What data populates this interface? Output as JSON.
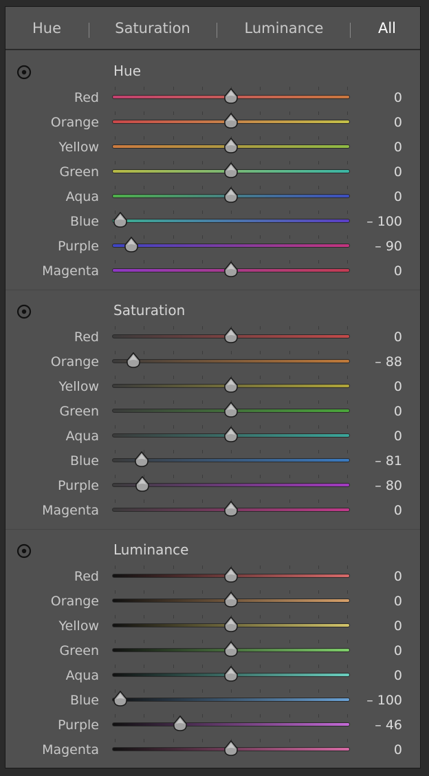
{
  "tabs": [
    {
      "label": "Hue",
      "active": false
    },
    {
      "label": "Saturation",
      "active": false
    },
    {
      "label": "Luminance",
      "active": false
    },
    {
      "label": "All",
      "active": true
    }
  ],
  "icons": {
    "target": "target-adjustment-icon",
    "thumb": "slider-thumb-icon"
  },
  "slider_range": [
    -100,
    100
  ],
  "sections": [
    {
      "key": "hue",
      "title": "Hue",
      "rows": [
        {
          "label": "Red",
          "value": 0,
          "display": "0",
          "colors": [
            "#c2416f",
            "#c9773f"
          ]
        },
        {
          "label": "Orange",
          "value": 0,
          "display": "0",
          "colors": [
            "#c9474a",
            "#c3c048"
          ]
        },
        {
          "label": "Yellow",
          "value": 0,
          "display": "0",
          "colors": [
            "#cc7a3f",
            "#8fbb45"
          ]
        },
        {
          "label": "Green",
          "value": 0,
          "display": "0",
          "colors": [
            "#b7b945",
            "#3bb6a5"
          ]
        },
        {
          "label": "Aqua",
          "value": 0,
          "display": "0",
          "colors": [
            "#4fb04a",
            "#3d4ec0"
          ]
        },
        {
          "label": "Blue",
          "value": -100,
          "display": "– 100",
          "colors": [
            "#3bb08f",
            "#5b3ec6"
          ]
        },
        {
          "label": "Purple",
          "value": -90,
          "display": "– 90",
          "colors": [
            "#3d45c4",
            "#c3357d"
          ]
        },
        {
          "label": "Magenta",
          "value": 0,
          "display": "0",
          "colors": [
            "#8d38c4",
            "#c33c52"
          ]
        }
      ]
    },
    {
      "key": "saturation",
      "title": "Saturation",
      "rows": [
        {
          "label": "Red",
          "value": 0,
          "display": "0",
          "colors": [
            "#3a3a3a",
            "#c24a4a"
          ]
        },
        {
          "label": "Orange",
          "value": -88,
          "display": "– 88",
          "colors": [
            "#3a3a3a",
            "#c07a3a"
          ]
        },
        {
          "label": "Yellow",
          "value": 0,
          "display": "0",
          "colors": [
            "#3a3a3a",
            "#b0a63a"
          ]
        },
        {
          "label": "Green",
          "value": 0,
          "display": "0",
          "colors": [
            "#3a3a3a",
            "#4aa63a"
          ]
        },
        {
          "label": "Aqua",
          "value": 0,
          "display": "0",
          "colors": [
            "#3a3a3a",
            "#3aa69a"
          ]
        },
        {
          "label": "Blue",
          "value": -81,
          "display": "– 81",
          "colors": [
            "#3a3a3a",
            "#3a7ac0"
          ]
        },
        {
          "label": "Purple",
          "value": -80,
          "display": "– 80",
          "colors": [
            "#3a3a3a",
            "#a23ac0"
          ]
        },
        {
          "label": "Magenta",
          "value": 0,
          "display": "0",
          "colors": [
            "#3a3a3a",
            "#c03a8a"
          ]
        }
      ]
    },
    {
      "key": "luminance",
      "title": "Luminance",
      "rows": [
        {
          "label": "Red",
          "value": 0,
          "display": "0",
          "colors": [
            "#111111",
            "#d86a6a"
          ]
        },
        {
          "label": "Orange",
          "value": 0,
          "display": "0",
          "colors": [
            "#111111",
            "#d6a06a"
          ]
        },
        {
          "label": "Yellow",
          "value": 0,
          "display": "0",
          "colors": [
            "#111111",
            "#d2c46a"
          ]
        },
        {
          "label": "Green",
          "value": 0,
          "display": "0",
          "colors": [
            "#111111",
            "#7fcf6a"
          ]
        },
        {
          "label": "Aqua",
          "value": 0,
          "display": "0",
          "colors": [
            "#111111",
            "#6acfbf"
          ]
        },
        {
          "label": "Blue",
          "value": -100,
          "display": "– 100",
          "colors": [
            "#111111",
            "#6aa2d6"
          ]
        },
        {
          "label": "Purple",
          "value": -46,
          "display": "– 46",
          "colors": [
            "#111111",
            "#c36ad6"
          ]
        },
        {
          "label": "Magenta",
          "value": 0,
          "display": "0",
          "colors": [
            "#111111",
            "#d66aa4"
          ]
        }
      ]
    }
  ]
}
